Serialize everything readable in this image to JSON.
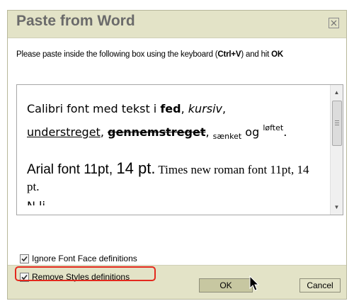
{
  "dialog": {
    "title": "Paste from Word",
    "close_icon": "close-x-icon",
    "instructions": {
      "part1": "Please paste inside the following box using the keyboard (",
      "shortcut": "Ctrl+V",
      "part2": ") and hit ",
      "ok_word": "OK"
    },
    "paste_content": {
      "line1": {
        "text1": "Calibri font med tekst i ",
        "bold": "fed",
        "sep1": ", ",
        "italic": "kursiv",
        "sep2": ","
      },
      "line2": {
        "underline": "understreget",
        "sep1": ", ",
        "strike": "gennemstreget",
        "sep2": ", ",
        "sub": "sænket",
        "og": " og ",
        "sup": "løftet",
        "end": "."
      },
      "line3": {
        "arial": "Arial font 11pt, ",
        "arial_big": "14 pt.",
        "times": " Times new roman font 11pt, 14 pt."
      },
      "line4_partial": "N        li"
    },
    "options": [
      {
        "label": "Ignore Font Face definitions",
        "checked": true
      },
      {
        "label": "Remove Styles definitions",
        "checked": true,
        "highlighted": true
      }
    ],
    "buttons": {
      "ok_label": "OK",
      "cancel_label": "Cancel"
    }
  },
  "colors": {
    "dialog_bg": "#e3e3c7",
    "title_text": "#6b6b6b",
    "highlight": "#e3291d",
    "ok_button": "#c7c7a1"
  }
}
